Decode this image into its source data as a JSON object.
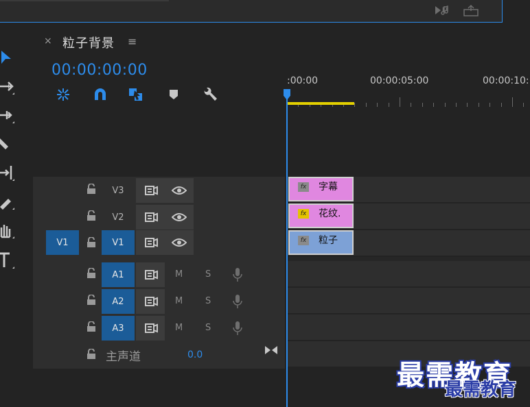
{
  "panel": {
    "title": "粒子背景",
    "close_glyph": "×",
    "menu_glyph": "≡"
  },
  "timecode": "00:00:00:00",
  "ruler": {
    "labels": [
      ":00:00",
      "00:00:05:00",
      "00:00:10:"
    ]
  },
  "header_tools": [
    "nest-sequence-icon",
    "snap-magnet-icon",
    "linked-selection-icon",
    "add-marker-icon",
    "timeline-settings-wrench-icon"
  ],
  "tools": [
    "selection-tool-icon",
    "track-select-forward-icon",
    "ripple-edit-icon",
    "razor-tool-icon",
    "slip-tool-icon",
    "pen-tool-icon",
    "hand-tool-icon",
    "type-tool-icon"
  ],
  "tracks": {
    "video": [
      {
        "name": "V3",
        "source": ""
      },
      {
        "name": "V2",
        "source": ""
      },
      {
        "name": "V1",
        "source": "V1"
      }
    ],
    "audio": [
      {
        "name": "A1",
        "mute": "M",
        "solo": "S"
      },
      {
        "name": "A2",
        "mute": "M",
        "solo": "S"
      },
      {
        "name": "A3",
        "mute": "M",
        "solo": "S"
      }
    ],
    "master": {
      "name": "主声道",
      "value": "0.0"
    }
  },
  "clips": [
    {
      "track": "V3",
      "name": "字幕",
      "fx": "fx",
      "color": "#e087e0"
    },
    {
      "track": "V2",
      "name": "花纹.",
      "fx": "fx",
      "color": "#e087e0"
    },
    {
      "track": "V1",
      "name": "粒子",
      "fx": "fx",
      "color": "#7da1d6"
    }
  ],
  "watermark": {
    "line1": "最需教育",
    "line2": "最需教育"
  },
  "colors": {
    "accent": "#2d8ceb",
    "active_track": "#1b5c98",
    "work_area": "#e3d000"
  }
}
